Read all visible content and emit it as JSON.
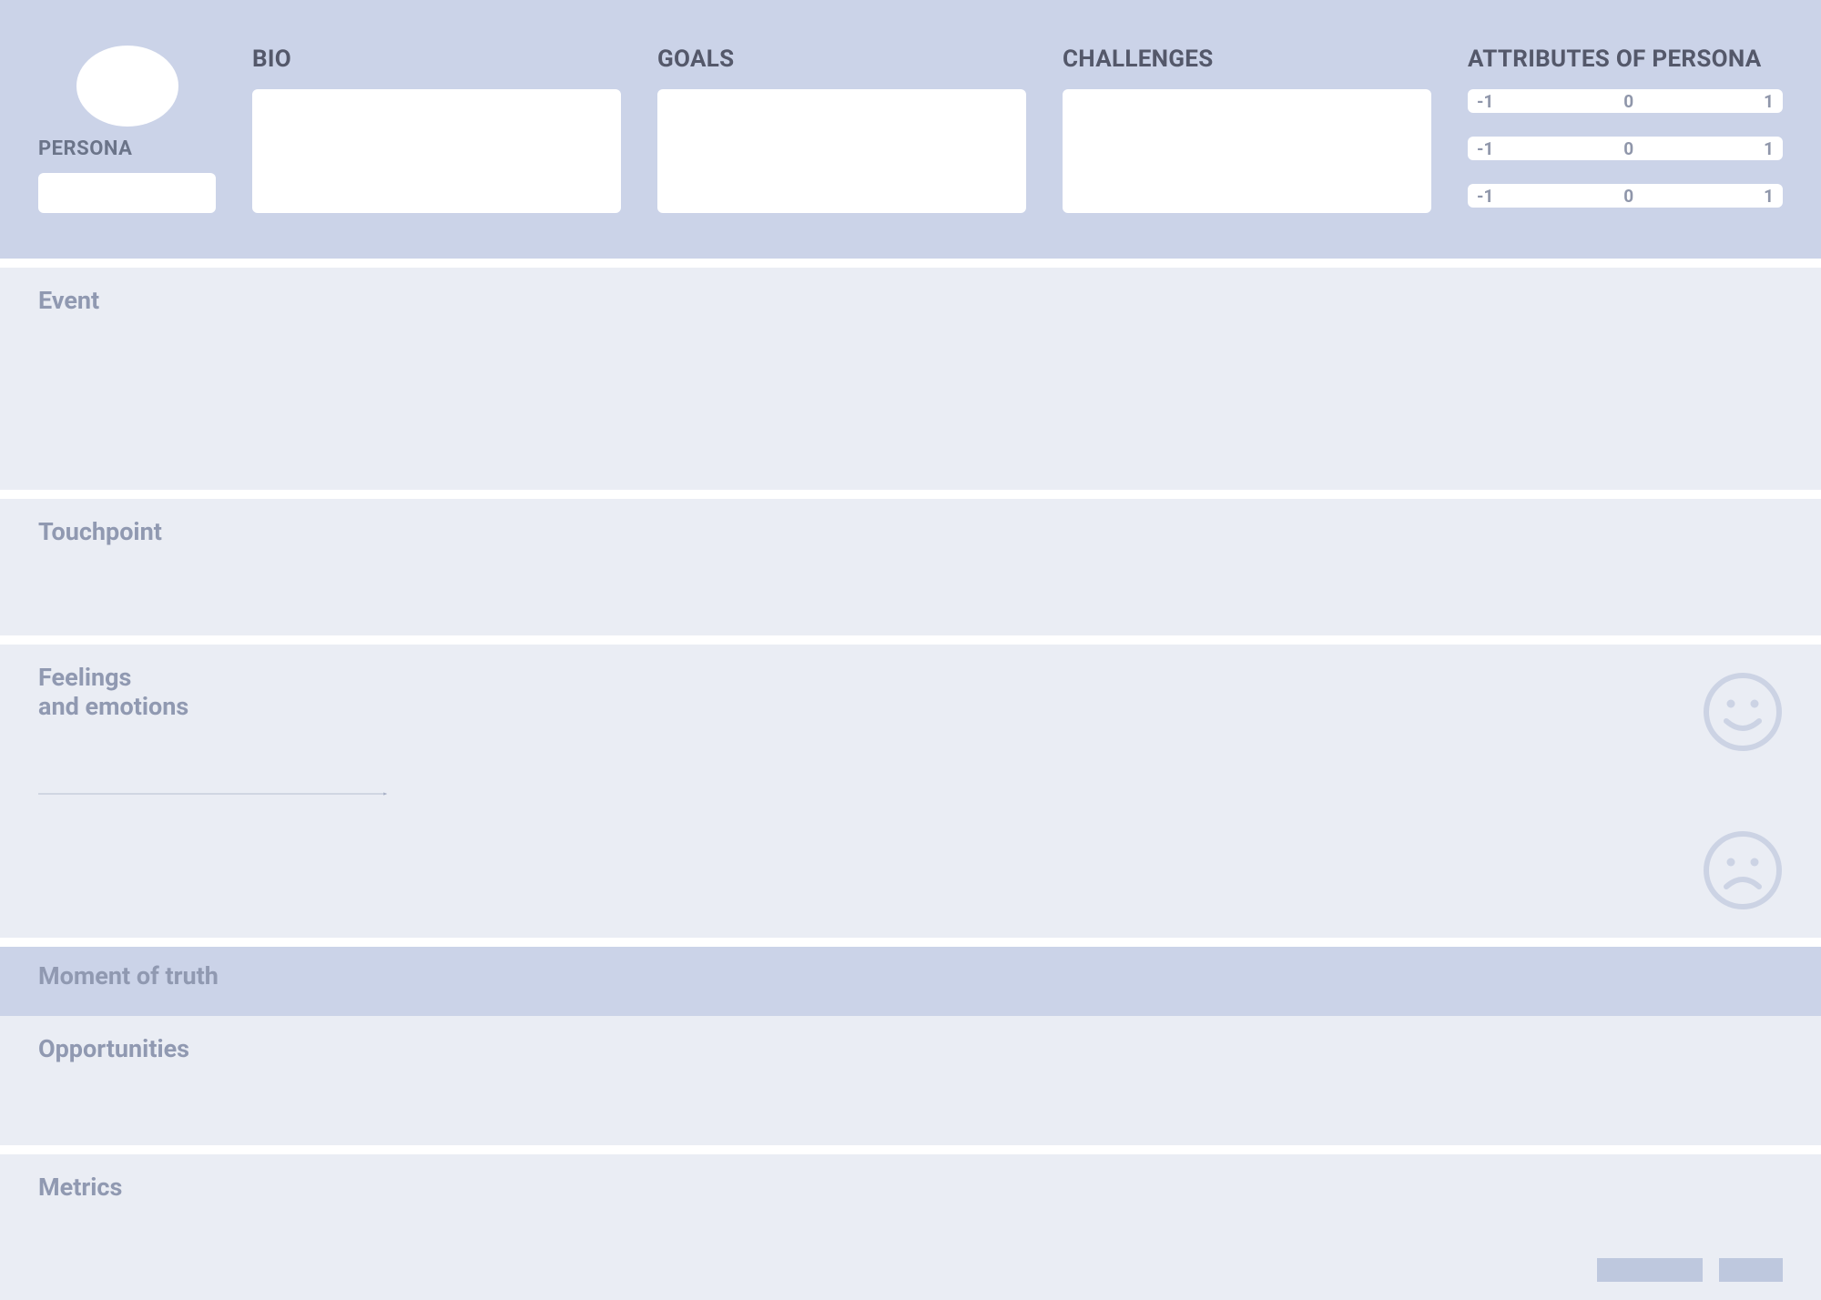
{
  "header": {
    "persona_label": "PERSONA",
    "bio_title": "BIO",
    "goals_title": "GOALS",
    "challenges_title": "CHALLENGES",
    "attributes_title": "ATTRIBUTES OF PERSONA",
    "scale": {
      "low": "-1",
      "mid": "0",
      "high": "1"
    }
  },
  "sections": {
    "event": "Event",
    "touchpoint": "Touchpoint",
    "feelings_line1": "Feelings",
    "feelings_line2": "and emotions",
    "moment": "Moment of truth",
    "opportunities": "Opportunities",
    "metrics": "Metrics"
  }
}
